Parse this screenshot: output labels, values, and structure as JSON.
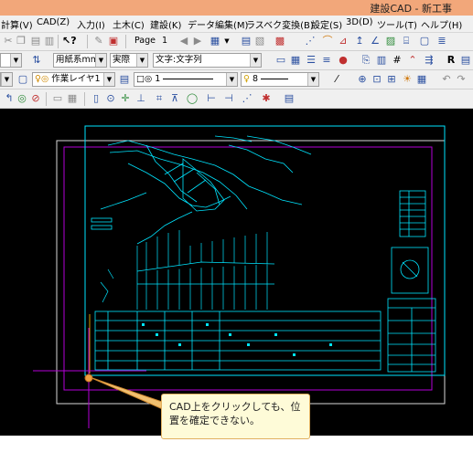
{
  "window": {
    "title": "建設CAD - 新工事"
  },
  "menu": [
    "計算(V)",
    "CAD(Z)",
    "入力(I)",
    "土木(C)",
    "建設(K)",
    "データ編集(M)",
    "ラスベク変換(B)",
    "設定(S)",
    "3D(D)",
    "ツール(T)",
    "ヘルプ(H)"
  ],
  "toolbar1": {
    "page_label": "Page",
    "page_number": "1"
  },
  "toolbar2": {
    "paper": "用紙系mm",
    "scale": "実際",
    "text_style": "文字:文字列"
  },
  "toolbar3": {
    "layer": "作業レイヤ1",
    "line_number": "1",
    "color_number": "8"
  },
  "callout": {
    "text": "CAD上をクリックしても、位置を確定できない。"
  },
  "colors": {
    "titlebar": "#f2a77a",
    "canvas": "#000000",
    "drawing": "#00e5ff",
    "frame_purple": "#b400d8",
    "callout_bg": "#fefbd8"
  }
}
